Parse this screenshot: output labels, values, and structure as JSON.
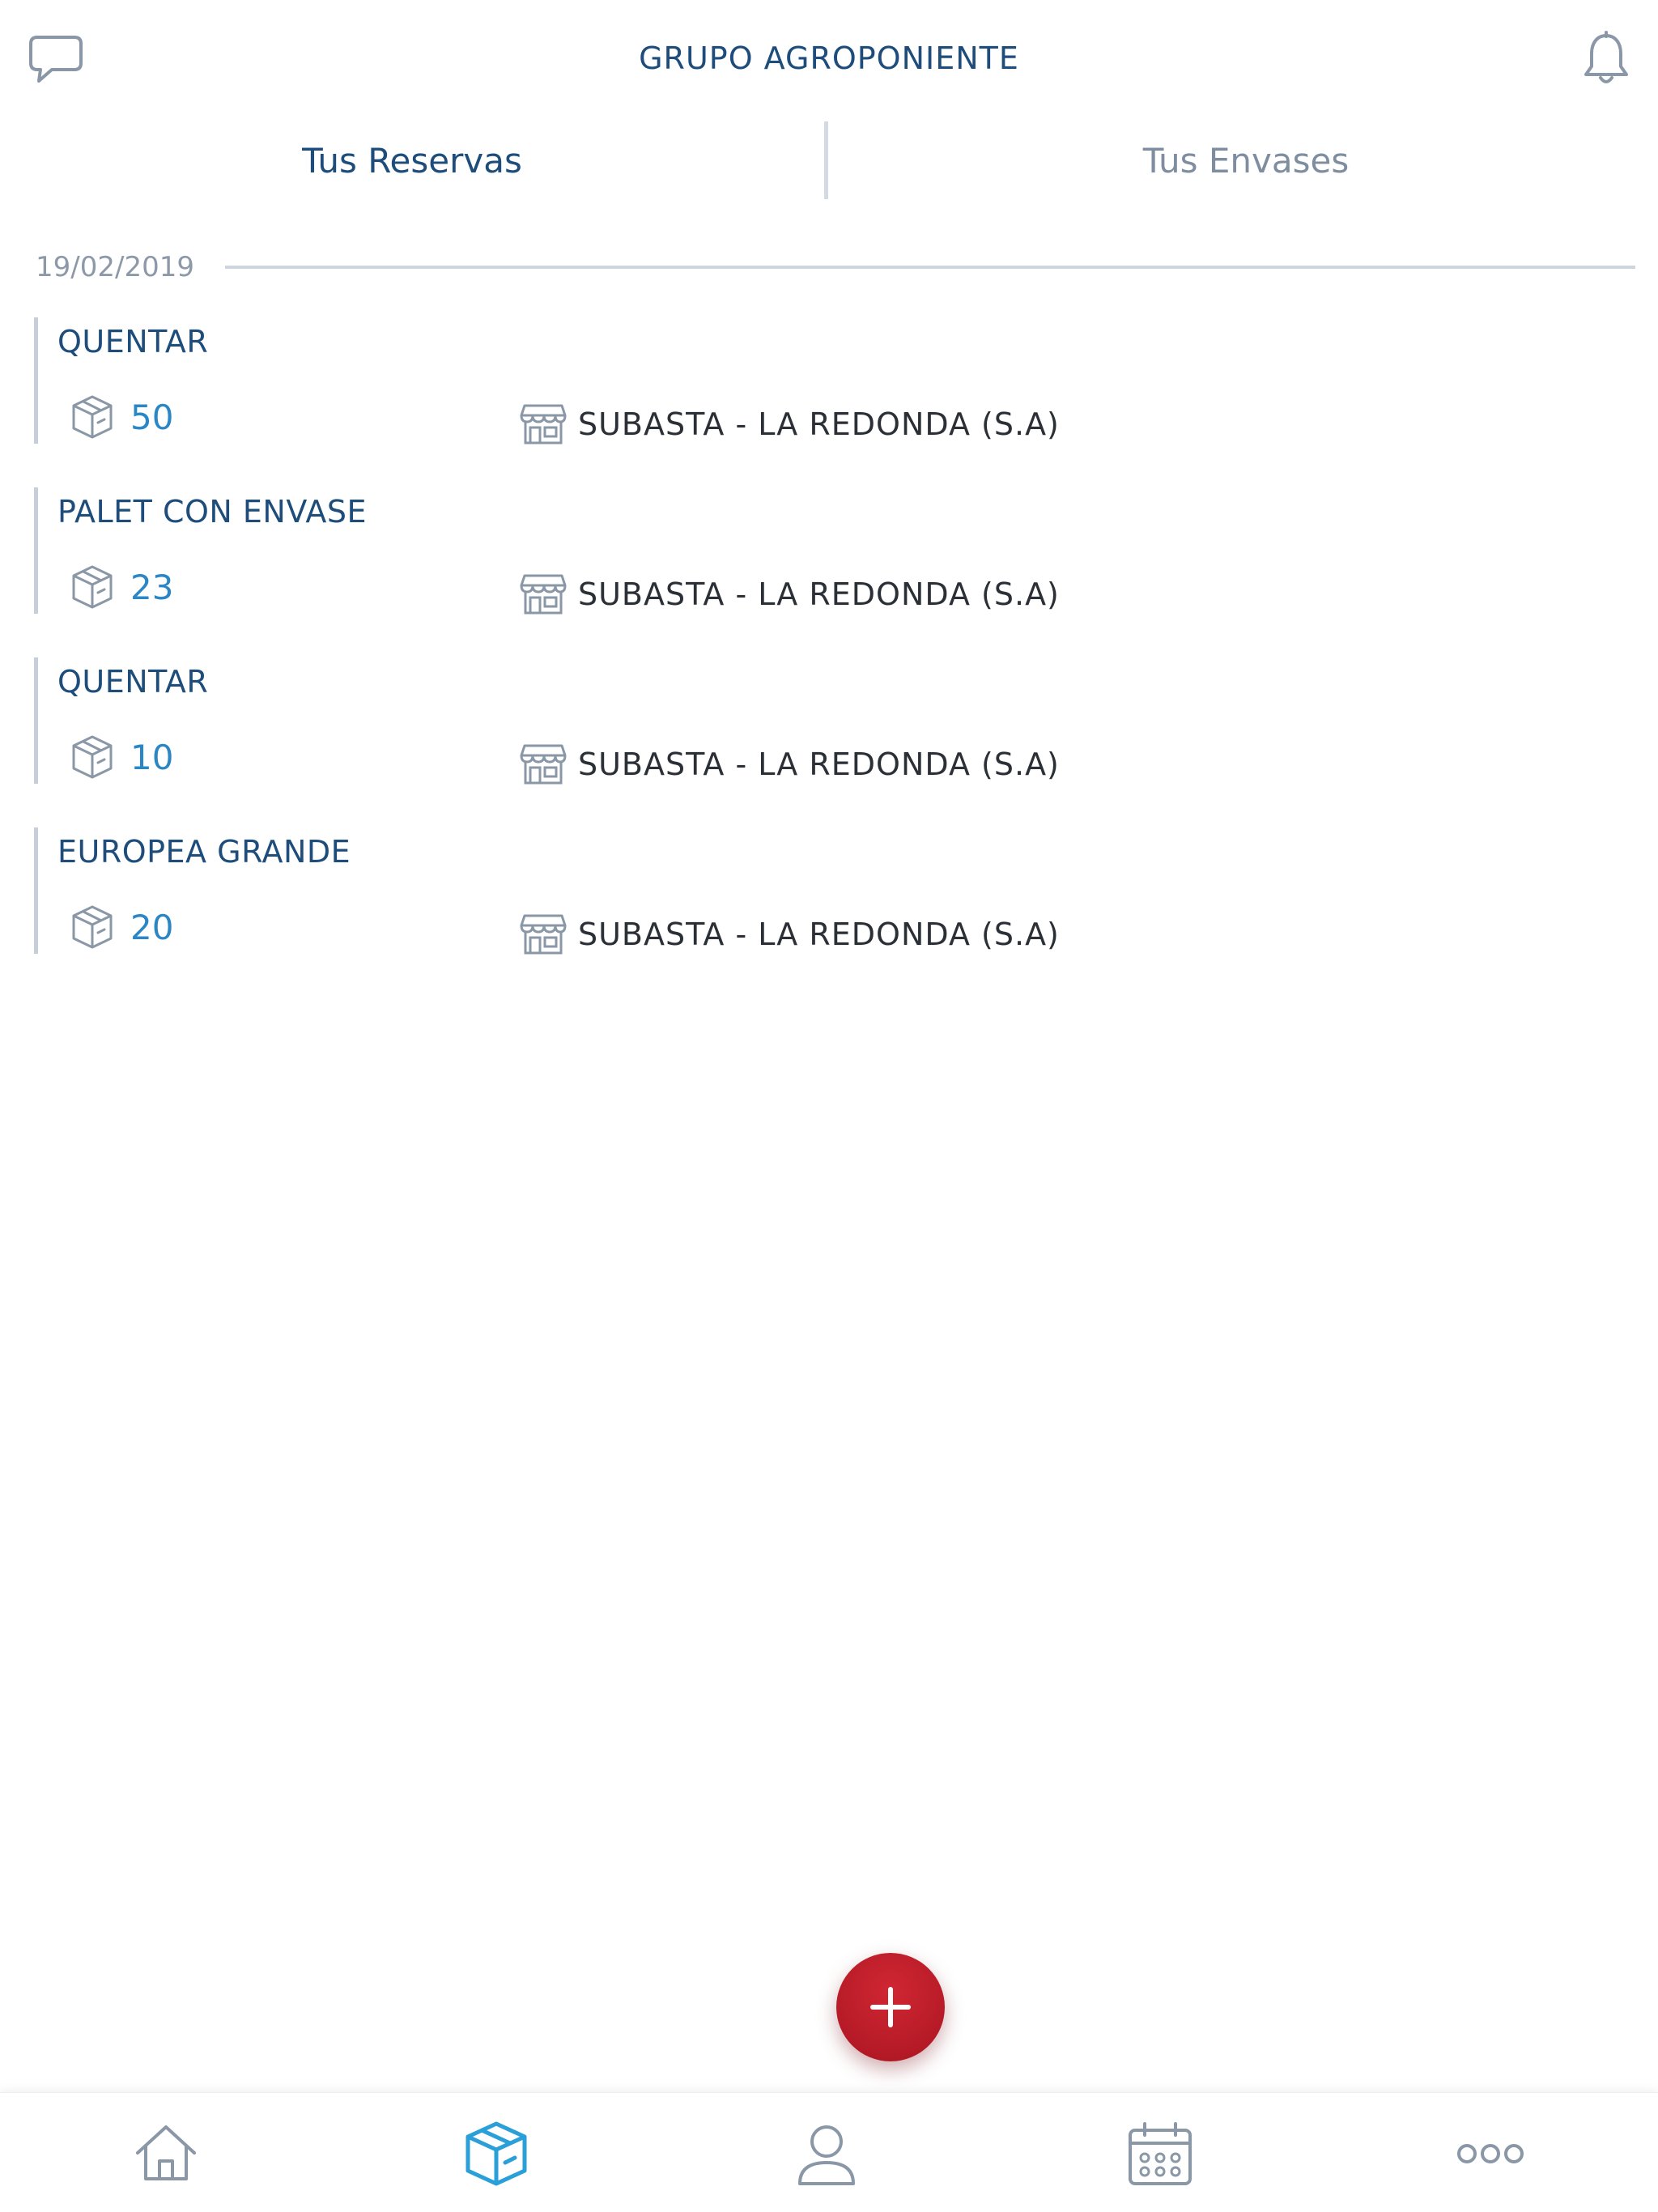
{
  "header": {
    "title": "GRUPO AGROPONIENTE",
    "left_icon": "chat-bubble-icon",
    "right_icon": "bell-icon"
  },
  "tabs": [
    {
      "label": "Tus Reservas",
      "active": true
    },
    {
      "label": "Tus Envases",
      "active": false
    }
  ],
  "date_group": {
    "date": "19/02/2019"
  },
  "reservations": [
    {
      "name": "QUENTAR",
      "quantity": "50",
      "place": "SUBASTA - LA REDONDA (S.A)"
    },
    {
      "name": "PALET CON ENVASE",
      "quantity": "23",
      "place": "SUBASTA - LA REDONDA (S.A)"
    },
    {
      "name": "QUENTAR",
      "quantity": "10",
      "place": "SUBASTA - LA REDONDA (S.A)"
    },
    {
      "name": "EUROPEA GRANDE",
      "quantity": "20",
      "place": "SUBASTA - LA REDONDA (S.A)"
    }
  ],
  "fab": {
    "icon": "plus-icon"
  },
  "bottom_nav": [
    {
      "icon": "home-icon",
      "active": false
    },
    {
      "icon": "box-icon",
      "active": true
    },
    {
      "icon": "user-icon",
      "active": false
    },
    {
      "icon": "calendar-icon",
      "active": false
    },
    {
      "icon": "more-icon",
      "active": false
    }
  ],
  "colors": {
    "primary": "#1e4d7b",
    "accent_blue": "#2a86c5",
    "fab_red": "#c0212e",
    "muted": "#8d99a8",
    "icon_gray": "#8a97a6"
  }
}
